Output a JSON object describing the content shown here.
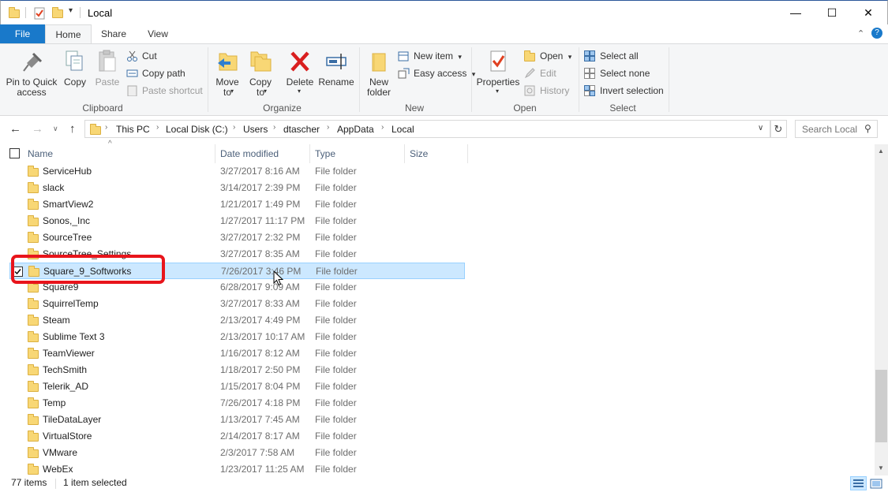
{
  "window": {
    "title": "Local",
    "minimize": "—",
    "maximize": "☐",
    "close": "✕"
  },
  "ribbon_tabs": {
    "file": "File",
    "home": "Home",
    "share": "Share",
    "view": "View"
  },
  "clipboard": {
    "pin": "Pin to Quick access",
    "copy": "Copy",
    "paste": "Paste",
    "cut": "Cut",
    "copy_path": "Copy path",
    "paste_shortcut": "Paste shortcut",
    "label": "Clipboard"
  },
  "organize": {
    "move_to": "Move to",
    "copy_to": "Copy to",
    "delete": "Delete",
    "rename": "Rename",
    "label": "Organize"
  },
  "new_group": {
    "new_folder": "New folder",
    "new_item": "New item",
    "easy_access": "Easy access",
    "label": "New"
  },
  "open_group": {
    "properties": "Properties",
    "open": "Open",
    "edit": "Edit",
    "history": "History",
    "label": "Open"
  },
  "select_group": {
    "select_all": "Select all",
    "select_none": "Select none",
    "invert": "Invert selection",
    "label": "Select"
  },
  "breadcrumb": [
    "This PC",
    "Local Disk (C:)",
    "Users",
    "dtascher",
    "AppData",
    "Local"
  ],
  "search": {
    "placeholder": "Search Local"
  },
  "columns": {
    "name": "Name",
    "date": "Date modified",
    "type": "Type",
    "size": "Size"
  },
  "files": [
    {
      "name": "ServiceHub",
      "date": "3/27/2017 8:16 AM",
      "type": "File folder"
    },
    {
      "name": "slack",
      "date": "3/14/2017 2:39 PM",
      "type": "File folder"
    },
    {
      "name": "SmartView2",
      "date": "1/21/2017 1:49 PM",
      "type": "File folder"
    },
    {
      "name": "Sonos,_Inc",
      "date": "1/27/2017 11:17 PM",
      "type": "File folder"
    },
    {
      "name": "SourceTree",
      "date": "3/27/2017 2:32 PM",
      "type": "File folder"
    },
    {
      "name": "SourceTree_Settings",
      "date": "3/27/2017 8:35 AM",
      "type": "File folder"
    },
    {
      "name": "Square_9_Softworks",
      "date": "7/26/2017 3:46 PM",
      "type": "File folder"
    },
    {
      "name": "Square9",
      "date": "6/28/2017 9:09 AM",
      "type": "File folder"
    },
    {
      "name": "SquirrelTemp",
      "date": "3/27/2017 8:33 AM",
      "type": "File folder"
    },
    {
      "name": "Steam",
      "date": "2/13/2017 4:49 PM",
      "type": "File folder"
    },
    {
      "name": "Sublime Text 3",
      "date": "2/13/2017 10:17 AM",
      "type": "File folder"
    },
    {
      "name": "TeamViewer",
      "date": "1/16/2017 8:12 AM",
      "type": "File folder"
    },
    {
      "name": "TechSmith",
      "date": "1/18/2017 2:50 PM",
      "type": "File folder"
    },
    {
      "name": "Telerik_AD",
      "date": "1/15/2017 8:04 PM",
      "type": "File folder"
    },
    {
      "name": "Temp",
      "date": "7/26/2017 4:18 PM",
      "type": "File folder"
    },
    {
      "name": "TileDataLayer",
      "date": "1/13/2017 7:45 AM",
      "type": "File folder"
    },
    {
      "name": "VirtualStore",
      "date": "2/14/2017 8:17 AM",
      "type": "File folder"
    },
    {
      "name": "VMware",
      "date": "2/3/2017 7:58 AM",
      "type": "File folder"
    },
    {
      "name": "WebEx",
      "date": "1/23/2017 11:25 AM",
      "type": "File folder"
    }
  ],
  "selected_index": 6,
  "status": {
    "items": "77 items",
    "selected": "1 item selected"
  }
}
